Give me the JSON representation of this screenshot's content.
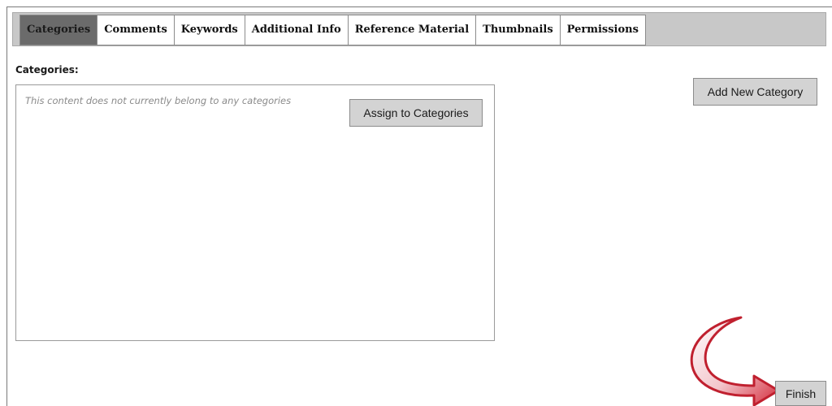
{
  "tabs": [
    {
      "label": "Categories",
      "active": true
    },
    {
      "label": "Comments",
      "active": false
    },
    {
      "label": "Keywords",
      "active": false
    },
    {
      "label": "Additional Info",
      "active": false
    },
    {
      "label": "Reference Material",
      "active": false
    },
    {
      "label": "Thumbnails",
      "active": false
    },
    {
      "label": "Permissions",
      "active": false
    }
  ],
  "categories_section": {
    "label": "Categories:",
    "empty_message": "This content does not currently belong to any categories",
    "assign_button": "Assign to Categories"
  },
  "add_category_button": "Add New Category",
  "finish_button": "Finish",
  "colors": {
    "tab_active_bg": "#6b6b6b",
    "tabbar_bg": "#c8c8c8",
    "button_bg": "#d3d3d3",
    "arrow_red": "#d42a3a"
  },
  "icons": {
    "callout_arrow": "curved-red-arrow-icon"
  }
}
